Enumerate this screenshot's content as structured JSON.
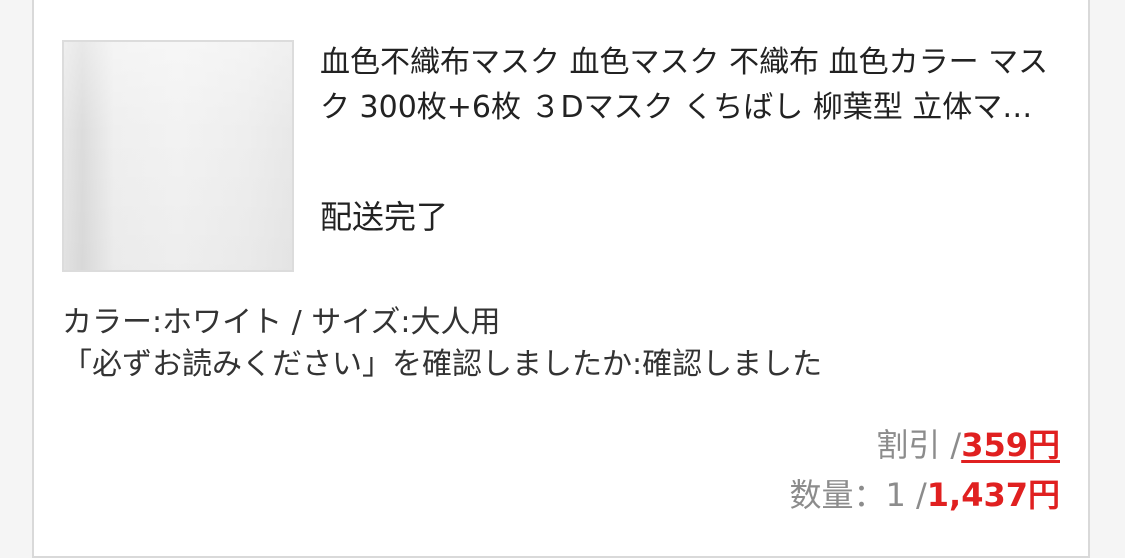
{
  "item": {
    "title": "血色不織布マスク 血色マスク 不織布 血色カラー マスク 300枚+6枚 ３Dマスク くちばし 柳葉型 立体マスク",
    "status": "配送完了",
    "options": [
      "カラー:ホワイト / サイズ:大人用",
      "「必ずお読みください」を確認しましたか:確認しました"
    ],
    "discount_label": "割引 / ",
    "discount_value": "359円",
    "quantity_label": "数量：1 / ",
    "total_value": "1,437円"
  },
  "colors": {
    "accent_red": "#e02020",
    "muted_gray": "#8c8c8c",
    "text_dark": "#222222"
  }
}
